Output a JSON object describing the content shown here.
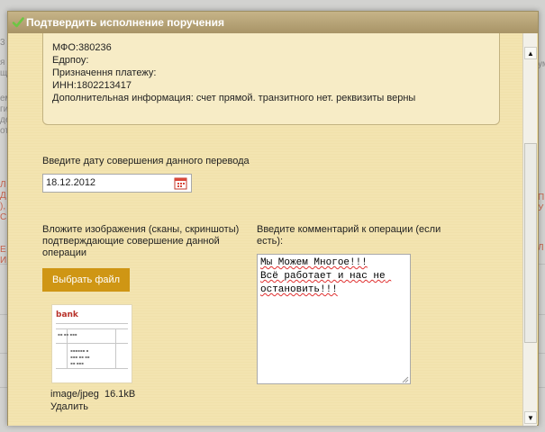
{
  "dialog": {
    "title": "Подтвердить исполнение поручения"
  },
  "info": {
    "lines": [
      "МФО:380236",
      "Едрпоу:",
      "Призначення платежу:",
      "ИНН:1802213417",
      "Дополнительная информация: счет прямой. транзитного нет. реквизиты верны"
    ]
  },
  "date_section": {
    "label": "Введите дату совершения данного перевода",
    "value": "18.12.2012"
  },
  "upload": {
    "label_line1": "Вложите изображения (сканы, скриншоты)",
    "label_line2": "подтверждающие совершение данной",
    "label_line3": "операции",
    "button_label": "Выбрать файл",
    "file_type": "image/jpeg",
    "file_size": "16.1kB",
    "delete_label": "Удалить"
  },
  "comment": {
    "label_line1": "Введите комментарий к операции (если",
    "label_line2": "есть):",
    "value": "Мы Можем Многое!!!\nВсё работает и нас не остановить!!!"
  },
  "icons": {
    "title_icon": "checkmark-icon",
    "date_icon": "calendar-icon",
    "scroll_up": "arrow-up-icon",
    "scroll_down": "arrow-down-icon"
  },
  "colors": {
    "dialog_bg": "#f3e4b0",
    "titlebar": "#b3a072",
    "button": "#cf9614",
    "check": "#6cc644"
  }
}
